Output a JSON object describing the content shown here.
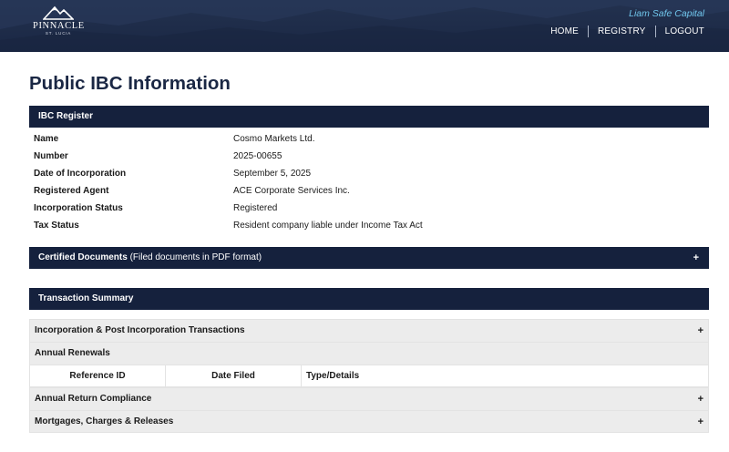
{
  "header": {
    "logo": {
      "name": "PINNACLE",
      "sub": "ST. LUCIA"
    },
    "brand_link": "Liam Safe Capital",
    "nav": [
      "HOME",
      "REGISTRY",
      "LOGOUT"
    ]
  },
  "page_title": "Public IBC Information",
  "ibc_register": {
    "title": "IBC Register",
    "rows": [
      {
        "label": "Name",
        "value": "Cosmo Markets Ltd."
      },
      {
        "label": "Number",
        "value": "2025-00655"
      },
      {
        "label": "Date of Incorporation",
        "value": "September 5, 2025"
      },
      {
        "label": "Registered Agent",
        "value": "ACE Corporate Services Inc."
      },
      {
        "label": "Incorporation Status",
        "value": "Registered"
      },
      {
        "label": "Tax Status",
        "value": "Resident company liable under Income Tax Act"
      }
    ]
  },
  "certified_documents": {
    "title": "Certified Documents",
    "note": "(Filed documents in PDF format)",
    "toggle": "+"
  },
  "transaction_summary": {
    "title": "Transaction Summary",
    "incorporation": {
      "label": "Incorporation & Post Incorporation Transactions",
      "toggle": "+"
    },
    "annual_renewals": {
      "label": "Annual Renewals",
      "columns": [
        "Reference ID",
        "Date Filed",
        "Type/Details"
      ]
    },
    "annual_return": {
      "label": "Annual Return Compliance",
      "toggle": "+"
    },
    "mortgages": {
      "label": "Mortgages, Charges & Releases",
      "toggle": "+"
    }
  },
  "colors": {
    "navy": "#15213d",
    "header_bg": "#1f2d4a",
    "accent_link": "#6fc4ea",
    "grey_row": "#ececec"
  }
}
